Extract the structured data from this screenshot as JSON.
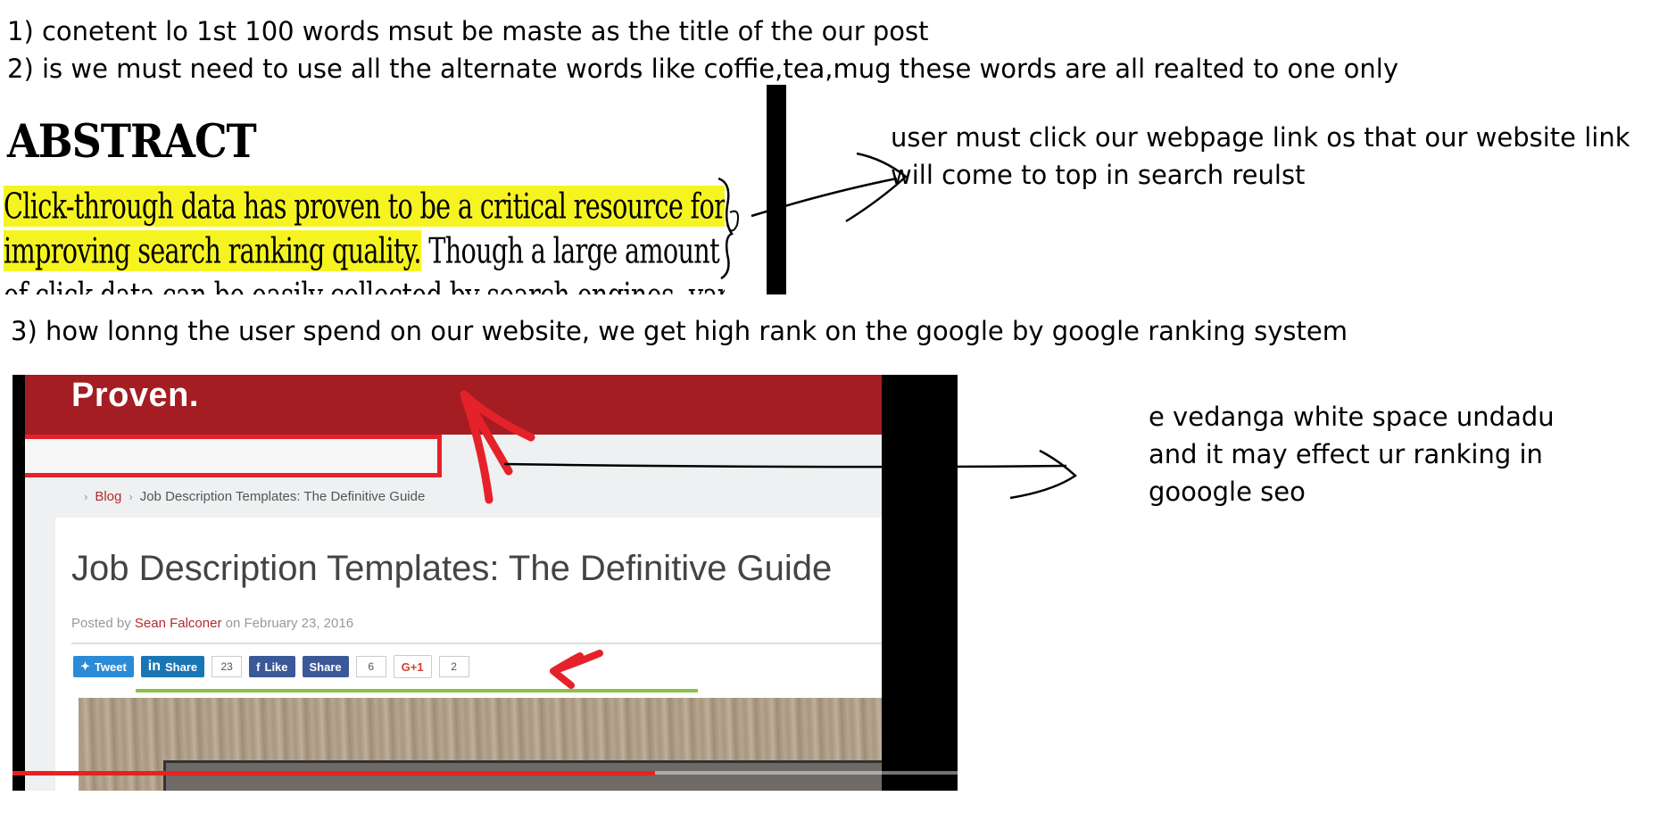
{
  "notes": {
    "point1": "1) conetent lo 1st 100 words msut be maste as the title of the our post",
    "point2": "2) is we must need to use all the alternate words like coffie,tea,mug these words are all realted to one only",
    "point3": "3) how lonng the user spend on our website, we get high rank on the google by google ranking system"
  },
  "abstract": {
    "heading": "ABSTRACT",
    "line1_highlight": "Click-through data has proven to be a critical resource for",
    "line2_highlight": "improving search ranking quality.",
    "line2_rest": " Though a large amount",
    "line3": "of click data can be easily collected by search engines, var"
  },
  "annotations": {
    "click_note_line1": "user must click our webpage link os that our website link",
    "click_note_line2": "will come to top in search reulst",
    "space_note_line1": "e vedanga white space undadu",
    "space_note_line2": "and it may effect ur ranking in",
    "space_note_line3": "gooogle seo"
  },
  "video": {
    "site_logo": "Proven.",
    "breadcrumb": {
      "blog": "Blog",
      "current": "Job Description Templates: The Definitive Guide"
    },
    "post_title": "Job Description Templates: The Definitive Guide",
    "posted_by_prefix": "Posted by ",
    "author": "Sean Falconer",
    "posted_on": " on February 23, 2016",
    "share": {
      "tweet": "Tweet",
      "linkedin": "Share",
      "linkedin_count": "23",
      "fb_like": "Like",
      "fb_share": "Share",
      "fb_count": "6",
      "gplus": "G+1",
      "gplus_count": "2"
    },
    "progress_fraction": 0.68,
    "colors": {
      "header": "#a41d23",
      "highlight_box": "#e5222a",
      "progress": "#e52222",
      "abstract_highlight": "#f6f420"
    }
  }
}
